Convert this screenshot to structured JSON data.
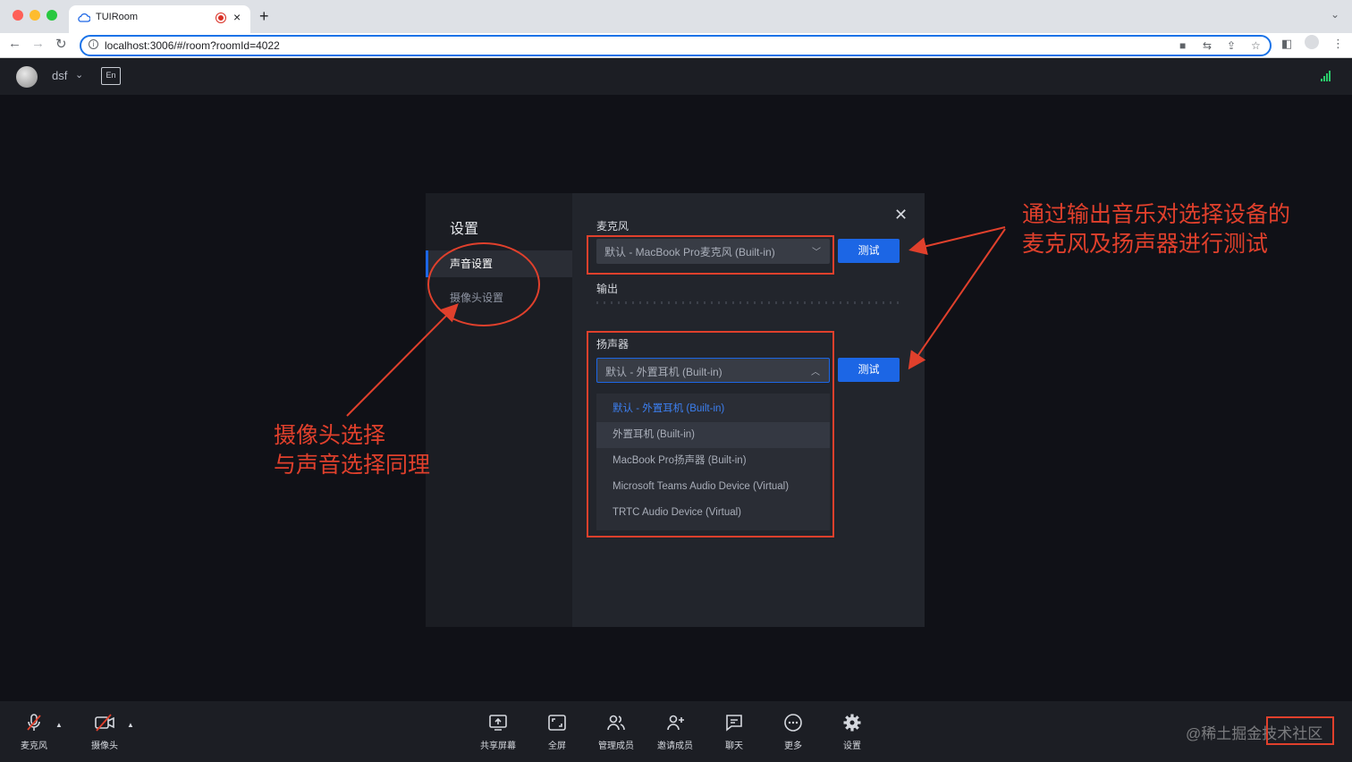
{
  "browser": {
    "tab_title": "TUIRoom",
    "url": "localhost:3006/#/room?roomId=4022"
  },
  "header": {
    "username": "dsf",
    "lang_icon": "En"
  },
  "settings": {
    "title": "设置",
    "nav": [
      {
        "label": "声音设置",
        "active": true
      },
      {
        "label": "摄像头设置",
        "active": false
      }
    ],
    "mic_label": "麦克风",
    "mic_value": "默认 - MacBook Pro麦克风 (Built-in)",
    "test_label": "测试",
    "output_label": "输出",
    "speaker_label": "扬声器",
    "speaker_value": "默认 - 外置耳机 (Built-in)",
    "speaker_options": [
      "默认 - 外置耳机 (Built-in)",
      "外置耳机 (Built-in)",
      "MacBook Pro扬声器 (Built-in)",
      "Microsoft Teams Audio Device (Virtual)",
      "TRTC Audio Device (Virtual)"
    ]
  },
  "annotations": {
    "right_line1": "通过输出音乐对选择设备的",
    "right_line2": "麦克风及扬声器进行测试",
    "left_line1": "摄像头选择",
    "left_line2": "与声音选择同理",
    "color": "#e0402c"
  },
  "toolbar": {
    "mic": "麦克风",
    "camera": "摄像头",
    "share": "共享屏幕",
    "fullscreen": "全屏",
    "manage": "管理成员",
    "invite": "邀请成员",
    "chat": "聊天",
    "more": "更多",
    "settings": "设置"
  },
  "watermark": "@稀土掘金技术社区"
}
